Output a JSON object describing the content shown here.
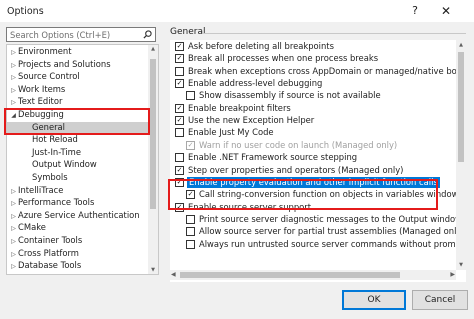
{
  "window": {
    "title": "Options",
    "help_glyph": "?",
    "close_glyph": "✕"
  },
  "search": {
    "placeholder": "Search Options (Ctrl+E)"
  },
  "tree": {
    "items": [
      {
        "label": "Environment",
        "expander": "▷"
      },
      {
        "label": "Projects and Solutions",
        "expander": "▷"
      },
      {
        "label": "Source Control",
        "expander": "▷"
      },
      {
        "label": "Work Items",
        "expander": "▷"
      },
      {
        "label": "Text Editor",
        "expander": "▷"
      },
      {
        "label": "Debugging",
        "expander": "◢"
      },
      {
        "label": "General",
        "expander": "",
        "selected": true
      },
      {
        "label": "Hot Reload",
        "expander": ""
      },
      {
        "label": "Just-In-Time",
        "expander": ""
      },
      {
        "label": "Output Window",
        "expander": ""
      },
      {
        "label": "Symbols",
        "expander": ""
      },
      {
        "label": "IntelliTrace",
        "expander": "▷"
      },
      {
        "label": "Performance Tools",
        "expander": "▷"
      },
      {
        "label": "Azure Service Authentication",
        "expander": "▷"
      },
      {
        "label": "CMake",
        "expander": "▷"
      },
      {
        "label": "Container Tools",
        "expander": "▷"
      },
      {
        "label": "Cross Platform",
        "expander": "▷"
      },
      {
        "label": "Database Tools",
        "expander": "▷"
      }
    ]
  },
  "section": {
    "title": "General"
  },
  "options": [
    {
      "label": "Ask before deleting all breakpoints",
      "checked": true,
      "indent": 0,
      "disabled": false
    },
    {
      "label": "Break all processes when one process breaks",
      "checked": true,
      "indent": 0,
      "disabled": false
    },
    {
      "label": "Break when exceptions cross AppDomain or managed/native boundaries",
      "checked": false,
      "indent": 0,
      "disabled": false
    },
    {
      "label": "Enable address-level debugging",
      "checked": true,
      "indent": 0,
      "disabled": false
    },
    {
      "label": "Show disassembly if source is not available",
      "checked": false,
      "indent": 1,
      "disabled": false
    },
    {
      "label": "Enable breakpoint filters",
      "checked": true,
      "indent": 0,
      "disabled": false
    },
    {
      "label": "Use the new Exception Helper",
      "checked": true,
      "indent": 0,
      "disabled": false
    },
    {
      "label": "Enable Just My Code",
      "checked": false,
      "indent": 0,
      "disabled": false
    },
    {
      "label": "Warn if no user code on launch (Managed only)",
      "checked": true,
      "indent": 1,
      "disabled": true
    },
    {
      "label": "Enable .NET Framework source stepping",
      "checked": false,
      "indent": 0,
      "disabled": false
    },
    {
      "label": "Step over properties and operators (Managed only)",
      "checked": true,
      "indent": 0,
      "disabled": false
    },
    {
      "label": "Enable property evaluation and other implicit function calls",
      "checked": true,
      "indent": 0,
      "disabled": false,
      "selected": true
    },
    {
      "label": "Call string-conversion function on objects in variables windows",
      "checked": true,
      "indent": 1,
      "disabled": false
    },
    {
      "label": "Enable source server support",
      "checked": true,
      "indent": 0,
      "disabled": false
    },
    {
      "label": "Print source server diagnostic messages to the Output window",
      "checked": false,
      "indent": 1,
      "disabled": false
    },
    {
      "label": "Allow source server for partial trust assemblies (Managed only)",
      "checked": false,
      "indent": 1,
      "disabled": false
    },
    {
      "label": "Always run untrusted source server commands without prompting",
      "checked": false,
      "indent": 1,
      "disabled": false
    }
  ],
  "buttons": {
    "ok": "OK",
    "cancel": "Cancel"
  },
  "colors": {
    "highlight_box": "#e41b1b",
    "selection": "#0078d7",
    "tree_selection": "#cfcfcf"
  }
}
